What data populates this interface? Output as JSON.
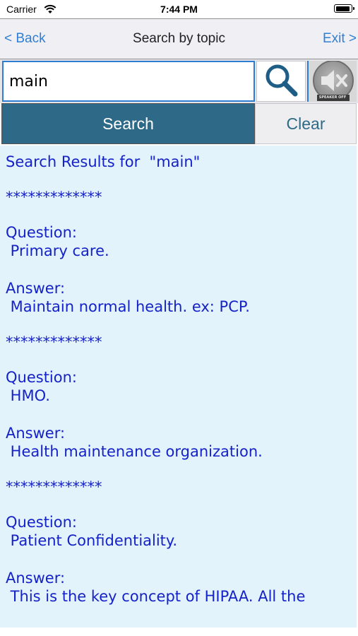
{
  "status": {
    "carrier": "Carrier",
    "time": "7:44 PM"
  },
  "nav": {
    "back_label": "< Back",
    "title": "Search by topic",
    "exit_label": "Exit >"
  },
  "search": {
    "value": "main",
    "speaker_caption": "SPEAKER OFF"
  },
  "actions": {
    "search_label": "Search",
    "clear_label": "Clear"
  },
  "results": {
    "header": "Search Results for  \"main\"",
    "separator": "*************",
    "items": [
      {
        "q_label": "Question:",
        "q_text": " Primary care.",
        "a_label": "Answer:",
        "a_text": " Maintain normal health. ex: PCP."
      },
      {
        "q_label": "Question:",
        "q_text": " HMO.",
        "a_label": "Answer:",
        "a_text": " Health maintenance organization."
      },
      {
        "q_label": "Question:",
        "q_text": " Patient Confidentiality.",
        "a_label": "Answer:",
        "a_text": " This is the key concept of HIPAA. All the"
      }
    ]
  }
}
